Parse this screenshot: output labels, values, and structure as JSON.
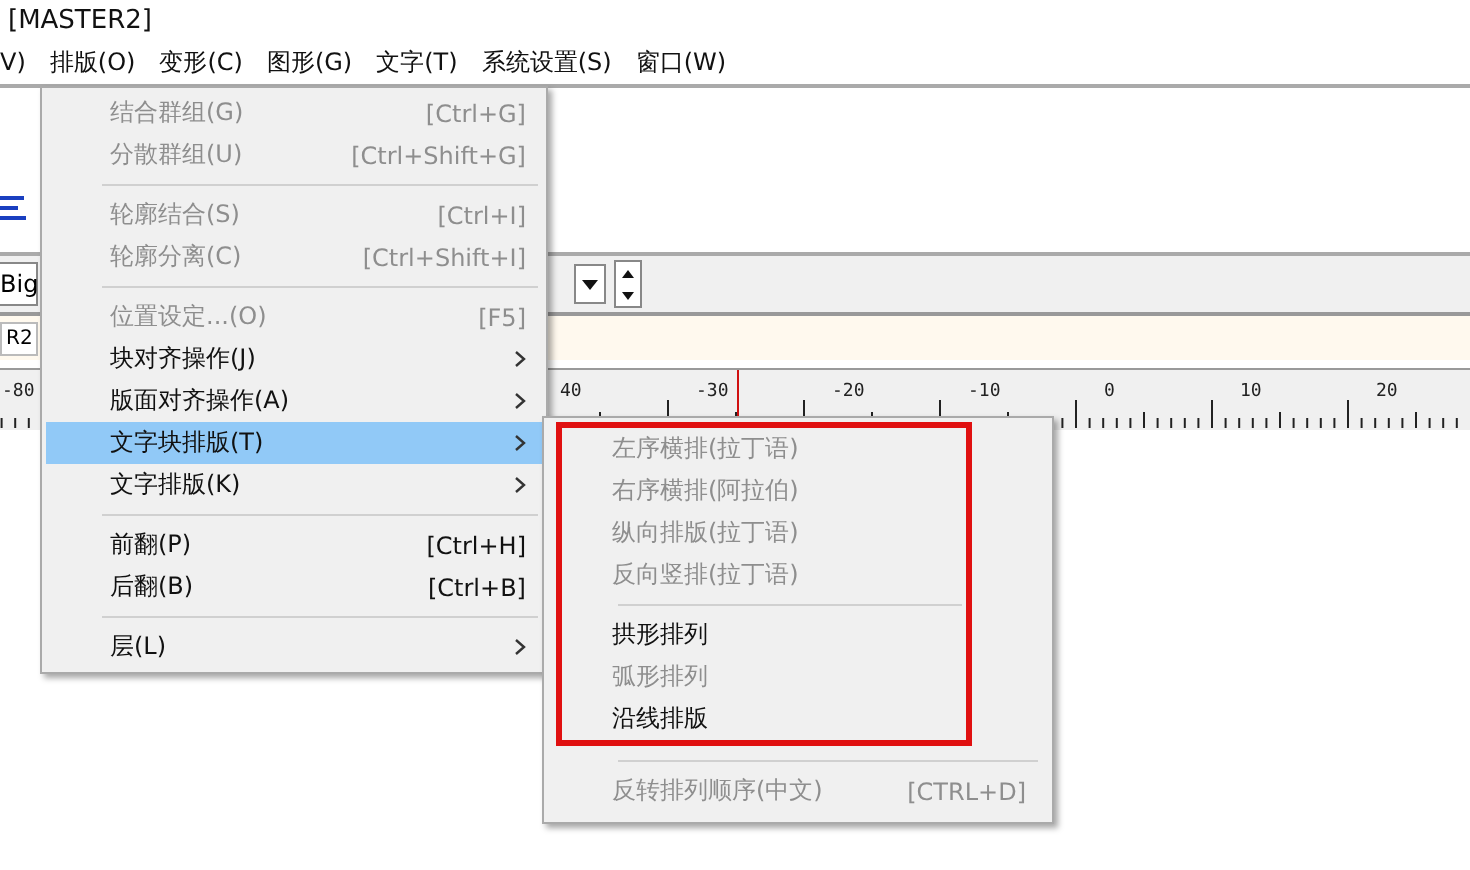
{
  "window": {
    "title": "[MASTER2]"
  },
  "menu_bar": [
    "V)",
    "排版(O)",
    "变形(C)",
    "图形(G)",
    "文字(T)",
    "系统设置(S)",
    "窗口(W)"
  ],
  "font_field": {
    "value": "Big"
  },
  "layer_tab": {
    "label": "R2"
  },
  "ruler": {
    "labels": [
      {
        "text": "-80"
      },
      {
        "text": "40"
      },
      {
        "text": "-30"
      },
      {
        "text": "-20"
      },
      {
        "text": "-10"
      },
      {
        "text": "0"
      },
      {
        "text": "10"
      },
      {
        "text": "20"
      }
    ]
  },
  "menu": {
    "items": [
      {
        "kind": "item",
        "label": "结合群组(G)",
        "shortcut": "[Ctrl+G]",
        "disabled": true,
        "selected": false,
        "has_submenu": false
      },
      {
        "kind": "item",
        "label": "分散群组(U)",
        "shortcut": "[Ctrl+Shift+G]",
        "disabled": true,
        "selected": false,
        "has_submenu": false
      },
      {
        "kind": "separator"
      },
      {
        "kind": "item",
        "label": "轮廓结合(S)",
        "shortcut": "[Ctrl+I]",
        "disabled": true,
        "selected": false,
        "has_submenu": false
      },
      {
        "kind": "item",
        "label": "轮廓分离(C)",
        "shortcut": "[Ctrl+Shift+I]",
        "disabled": true,
        "selected": false,
        "has_submenu": false
      },
      {
        "kind": "separator"
      },
      {
        "kind": "item",
        "label": "位置设定...(O)",
        "shortcut": "[F5]",
        "disabled": true,
        "selected": false,
        "has_submenu": false
      },
      {
        "kind": "item",
        "label": "块对齐操作(J)",
        "disabled": false,
        "selected": false,
        "has_submenu": true
      },
      {
        "kind": "item",
        "label": "版面对齐操作(A)",
        "disabled": false,
        "selected": false,
        "has_submenu": true
      },
      {
        "kind": "item",
        "label": "文字块排版(T)",
        "disabled": false,
        "selected": true,
        "has_submenu": true
      },
      {
        "kind": "item",
        "label": "文字排版(K)",
        "disabled": false,
        "selected": false,
        "has_submenu": true
      },
      {
        "kind": "separator"
      },
      {
        "kind": "item",
        "label": "前翻(P)",
        "shortcut": "[Ctrl+H]",
        "disabled": false,
        "selected": false,
        "has_submenu": false
      },
      {
        "kind": "item",
        "label": "后翻(B)",
        "shortcut": "[Ctrl+B]",
        "disabled": false,
        "selected": false,
        "has_submenu": false
      },
      {
        "kind": "separator"
      },
      {
        "kind": "item",
        "label": "层(L)",
        "disabled": false,
        "selected": false,
        "has_submenu": true
      }
    ]
  },
  "submenu": {
    "sections": [
      {
        "framed": true,
        "items": [
          {
            "kind": "item",
            "label": "左序横排(拉丁语)",
            "disabled": true
          },
          {
            "kind": "item",
            "label": "右序横排(阿拉伯)",
            "disabled": true
          },
          {
            "kind": "item",
            "label": "纵向排版(拉丁语)",
            "disabled": true
          },
          {
            "kind": "item",
            "label": "反向竖排(拉丁语)",
            "disabled": true
          },
          {
            "kind": "separator"
          },
          {
            "kind": "item",
            "label": "拱形排列",
            "disabled": false
          },
          {
            "kind": "item",
            "label": "弧形排列",
            "disabled": true
          },
          {
            "kind": "item",
            "label": "沿线排版",
            "disabled": false
          }
        ]
      },
      {
        "framed": false,
        "items": [
          {
            "kind": "separator"
          },
          {
            "kind": "item",
            "label": "反转排列顺序(中文)",
            "shortcut": "[CTRL+D]",
            "disabled": true
          }
        ]
      }
    ]
  }
}
